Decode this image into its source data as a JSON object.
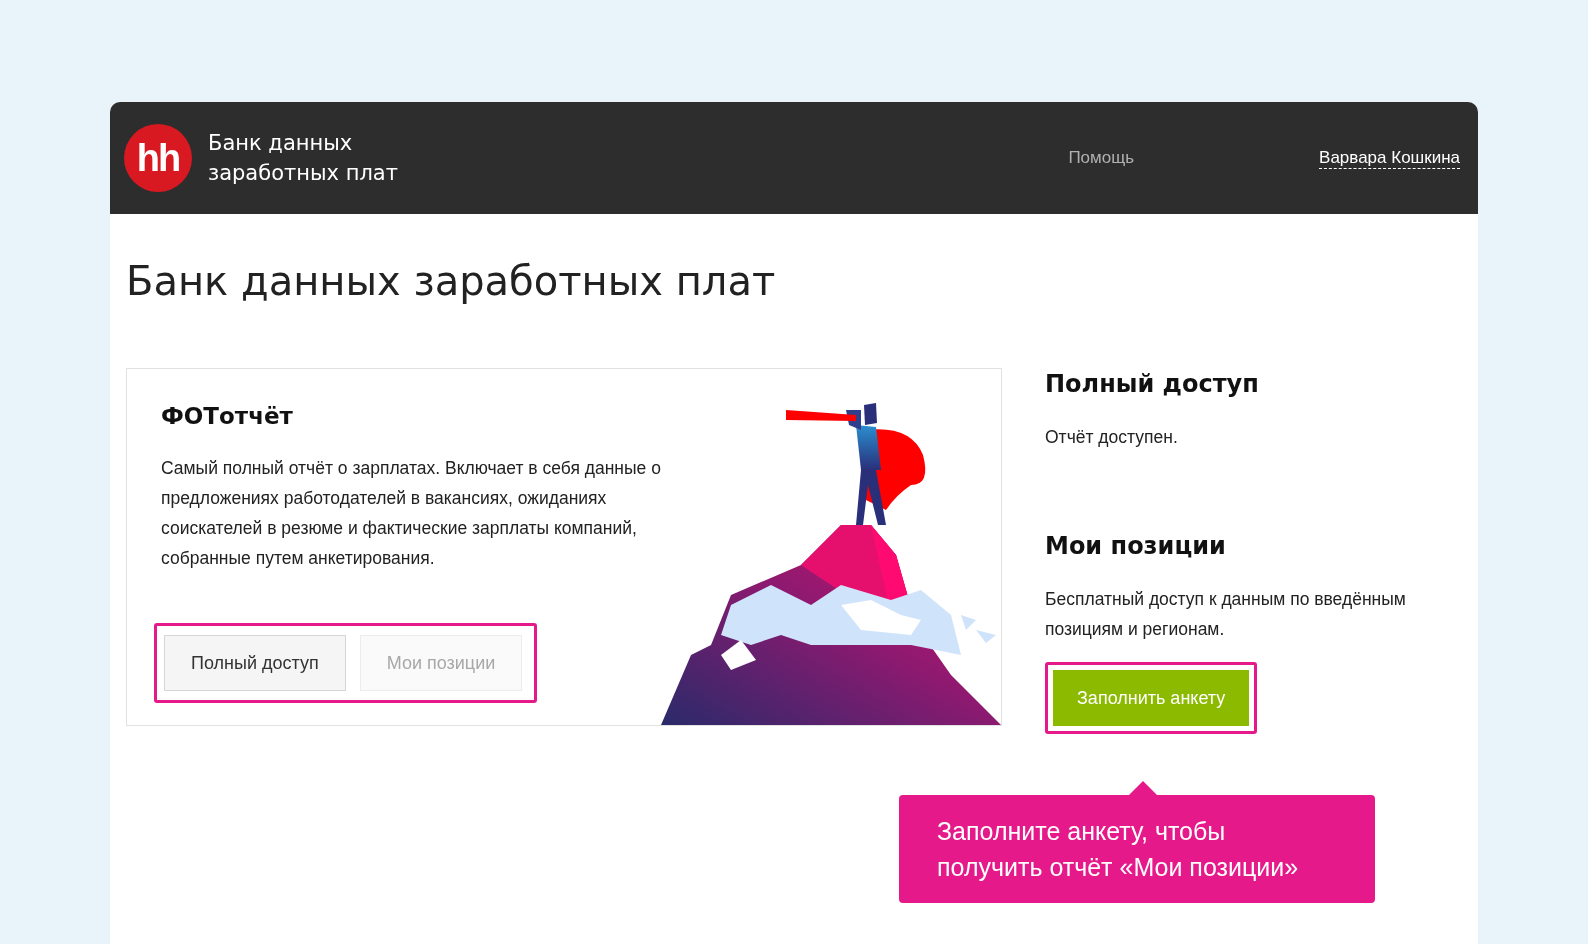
{
  "header": {
    "logo": "hh",
    "title_line_1": "Банк данных",
    "title_line_2": "заработных плат",
    "nav": [
      {
        "kind": "link",
        "label": "Помощь"
      },
      {
        "kind": "user",
        "label": "Варвара Кошкина"
      }
    ]
  },
  "page_title": "Банк данных заработных плат",
  "report_card": {
    "title": "ФОТотчёт",
    "description": "Самый полный отчёт о зарплатах. Включает в себя данные о предложениях работодателей в вакансиях, ожиданиях соискателей в резюме и фактические зарплаты компаний, собранные путем анкетирования.",
    "buttons_highlighted": true,
    "buttons": [
      {
        "label": "Полный доступ",
        "disabled": false
      },
      {
        "label": "Мои позиции",
        "disabled": true
      }
    ]
  },
  "sections": [
    {
      "title": "Полный доступ",
      "text": "Отчёт доступен."
    },
    {
      "title": "Мои позиции",
      "text": "Бесплатный доступ к данным по введённым позициям и регионам.",
      "button": {
        "label": "Заполнить анкету",
        "highlighted": true
      }
    }
  ],
  "tooltip": {
    "text": "Заполните анкету, чтобы получить отчёт «Мои позиции»"
  }
}
